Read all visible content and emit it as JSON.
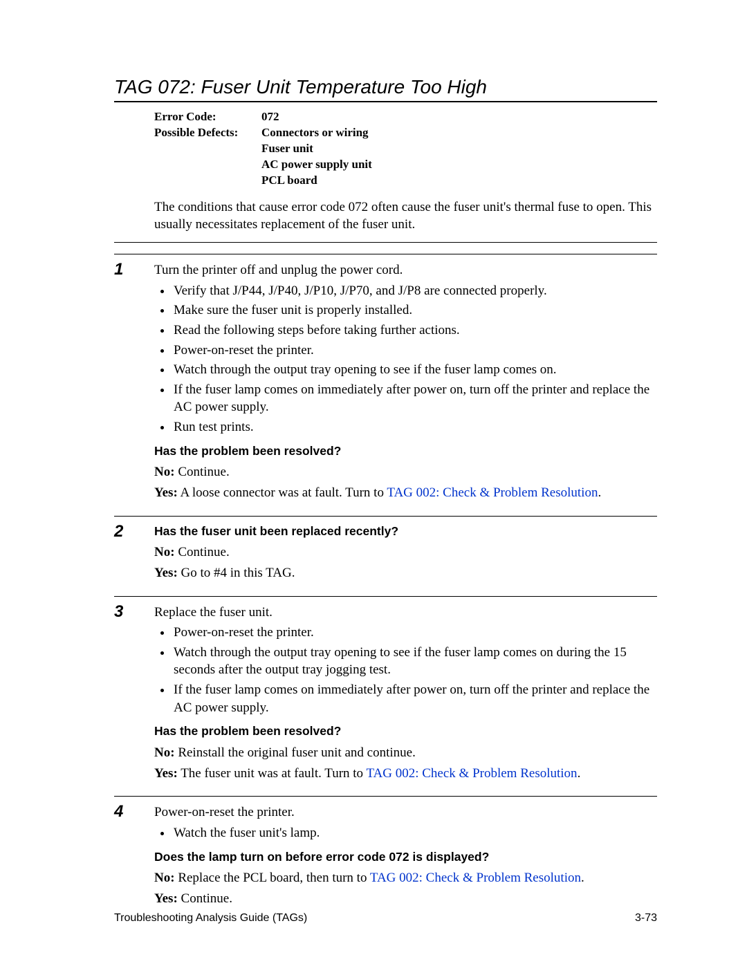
{
  "title": "TAG 072: Fuser Unit Temperature Too High",
  "meta": {
    "error_label": "Error Code:",
    "error_value": "072",
    "defects_label": "Possible Defects:",
    "defects": [
      "Connectors or wiring",
      "Fuser unit",
      "AC power supply unit",
      "PCL board"
    ]
  },
  "intro": "The conditions that cause error code 072 often cause the fuser unit's thermal fuse to open. This usually necessitates replacement of the fuser unit.",
  "steps": {
    "s1": {
      "num": "1",
      "lead": "Turn the printer off and unplug the power cord.",
      "bullets": [
        "Verify that J/P44, J/P40, J/P10, J/P70, and J/P8 are connected properly.",
        "Make sure the fuser unit is properly installed.",
        "Read the following steps before taking further actions.",
        "Power-on-reset the printer.",
        "Watch through the output tray opening to see if the fuser lamp comes on.",
        "If the fuser lamp comes on immediately after power on, turn off the printer and replace the AC power supply.",
        "Run test prints."
      ],
      "question": "Has the problem been resolved?",
      "no_label": "No:",
      "no_text": "  Continue.",
      "yes_label": "Yes:",
      "yes_text_a": " A loose connector was at fault. Turn to ",
      "yes_link": "TAG 002: Check & Problem Resolution",
      "yes_text_b": "."
    },
    "s2": {
      "num": "2",
      "question": "Has the fuser unit been replaced recently?",
      "no_label": "No:",
      "no_text": "  Continue.",
      "yes_label": "Yes:",
      "yes_text": " Go to #4 in this TAG."
    },
    "s3": {
      "num": "3",
      "lead": "Replace the fuser unit.",
      "bullets": [
        "Power-on-reset the printer.",
        "Watch through the output tray opening to see if the fuser lamp comes on during the 15 seconds after the output tray jogging test.",
        "If the fuser lamp comes on immediately after power on, turn off the printer and replace the AC power supply."
      ],
      "question": "Has the problem been resolved?",
      "no_label": "No:",
      "no_text": "  Reinstall the original fuser unit and continue.",
      "yes_label": "Yes:",
      "yes_text_a": " The fuser unit was at fault. Turn to ",
      "yes_link": "TAG 002: Check & Problem Resolution",
      "yes_text_b": "."
    },
    "s4": {
      "num": "4",
      "lead": "Power-on-reset the printer.",
      "bullets": [
        "Watch the fuser unit's lamp."
      ],
      "question": "Does the lamp turn on before error code 072 is displayed?",
      "no_label": "No:",
      "no_text_a": "  Replace the PCL board, then turn to ",
      "no_link": "TAG 002: Check & Problem Resolution",
      "no_text_b": ".",
      "yes_label": "Yes:",
      "yes_text": " Continue."
    }
  },
  "footer": {
    "left": "Troubleshooting Analysis Guide (TAGs)",
    "right": "3-73"
  }
}
